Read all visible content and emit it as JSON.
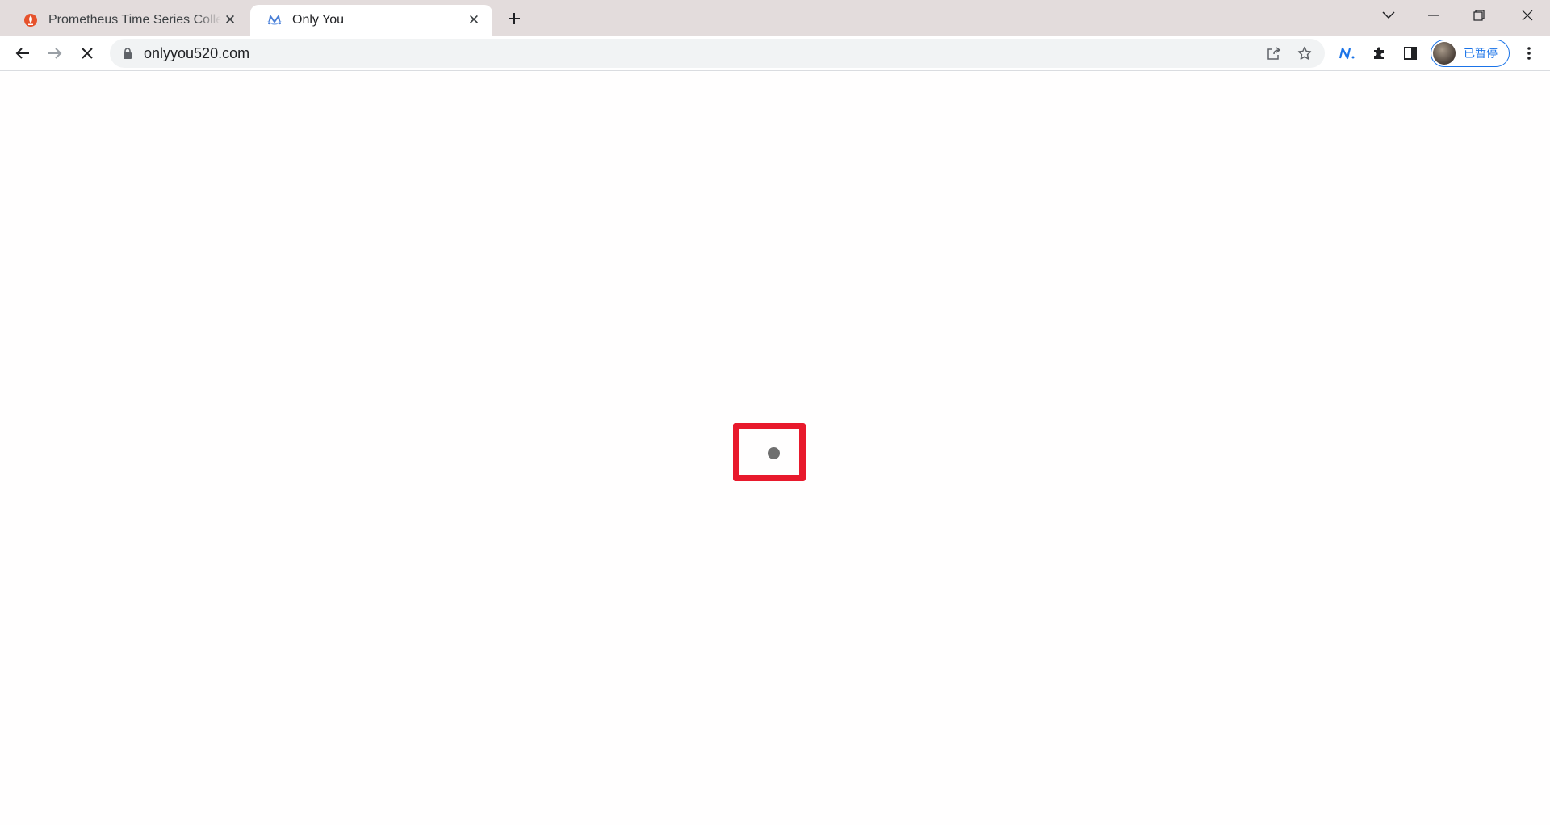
{
  "tabs": [
    {
      "title": "Prometheus Time Series Colle",
      "favicon": "prometheus-flame-icon",
      "active": false
    },
    {
      "title": "Only You",
      "favicon": "onlyyou-logo-icon",
      "active": true
    }
  ],
  "toolbar": {
    "url": "onlyyou520.com",
    "profile_label": "已暂停"
  },
  "colors": {
    "tabstrip_bg": "#e3dcdc",
    "accent": "#1a73e8",
    "highlight": "#e8192c"
  },
  "icons": {
    "back": "back-arrow-icon",
    "forward": "forward-arrow-icon",
    "stop": "stop-loading-icon",
    "lock": "lock-icon",
    "share": "share-icon",
    "bookmark": "star-icon",
    "extension_n": "n-extension-icon",
    "extensions": "puzzle-icon",
    "side_panel": "side-panel-icon",
    "menu": "kebab-menu-icon"
  }
}
